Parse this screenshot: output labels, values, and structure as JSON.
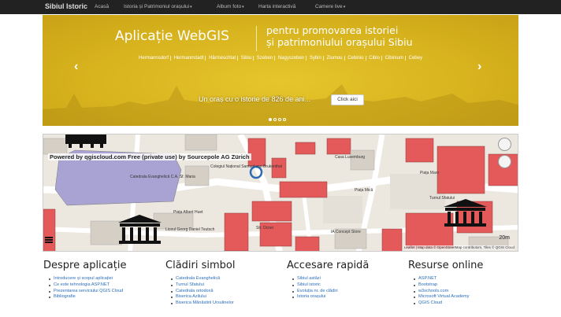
{
  "navbar": {
    "brand": "Sibiul Istoric",
    "items": [
      {
        "label": "Acasă",
        "dropdown": false
      },
      {
        "label": "Istoria și Patrimoniul orașului",
        "dropdown": true
      },
      {
        "label": "Album foto",
        "dropdown": true
      },
      {
        "label": "Harta interactivă",
        "dropdown": false
      },
      {
        "label": "Camere live",
        "dropdown": true
      }
    ]
  },
  "carousel": {
    "title": "Aplicație WebGIS",
    "subtitle_line1": "pentru promovarea istoriei",
    "subtitle_line2": "și patrimoniului orașului Sibiu",
    "names": [
      "Hermannsdorf",
      "Hermannstadt",
      "Hărmeschtat",
      "Sibiu",
      "Szeben",
      "Nagyszeben",
      "Sybin",
      "Ziumou",
      "Cebinio",
      "Ciblo",
      "Cibinium",
      "Cebey"
    ],
    "caption": "Un oraș cu o istorie de 826 de ani...",
    "button": "Click aici",
    "prev_icon": "chevron-left-icon",
    "next_icon": "chevron-right-icon",
    "slides": 4,
    "active_slide": 0,
    "accent": "#d9b51f"
  },
  "map": {
    "credit": "Powered by qgiscloud.com Free (private use) by Sourcepole AG Zürich",
    "scale": "20m",
    "attribution": "Leaflet | Map data © OpenStreetMap contributors, Tiles © QGIS Cloud",
    "labels": {
      "church": "Catedrala Evanghelică C.A. Sf. Maria",
      "piata_mica": "Piața Mică",
      "albert_huet": "Piața Albert Huet",
      "casa_luxemburg": "Casa Luxemburg",
      "turnul_sfatului": "Turnul Sfatului",
      "piata_mare": "Piața Mare",
      "liceul": "Colegiul Național Samuel von Brukenthal",
      "ia_concept": "IA Concept Store",
      "ocna": "Str. Ocnei",
      "teutsch": "Liceul Georg Daniel Teutsch"
    },
    "icons": [
      "building-icon",
      "landmark-icon",
      "landmark-icon",
      "compass-icon",
      "zoom-in-icon",
      "zoom-out-icon",
      "menu-icon"
    ]
  },
  "sections": [
    {
      "title": "Despre aplicație",
      "items": [
        "Introducere și scopul aplicației",
        "Ce este tehnologia ASP.NET",
        "Prezentarea serviciului QGIS Cloud",
        "Bibliografie"
      ]
    },
    {
      "title": "Clădiri simbol",
      "items": [
        "Catedrala Evanghelică",
        "Turnul Sfatului",
        "Catedrala ortodoxă",
        "Biserica Azilului",
        "Biserica Mănăstirii Ursulinelor"
      ]
    },
    {
      "title": "Accesare rapidă",
      "items": [
        "Sibiul astăzi",
        "Sibiul istoric",
        "Evoluția nr. de clădiri",
        "Istoria orașului"
      ]
    },
    {
      "title": "Resurse online",
      "items": [
        "ASP.NET",
        "Bootstrap",
        "w3schools.com",
        "Microsoft Virtual Academy",
        "QGIS Cloud"
      ]
    }
  ]
}
